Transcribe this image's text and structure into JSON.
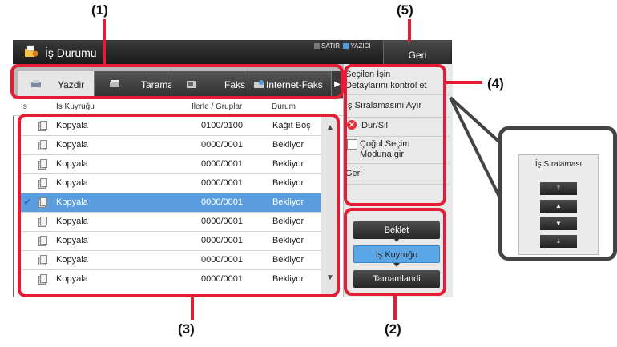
{
  "callouts": [
    "(1)",
    "(5)",
    "(4)",
    "(3)",
    "(2)"
  ],
  "window": {
    "title": "İş Durumu",
    "back": "Geri",
    "indicator_1": "SATIR",
    "indicator_2": "YAZICI"
  },
  "tabs": [
    {
      "label": "Yazdir",
      "icon": "printer-icon"
    },
    {
      "label": "Tarama",
      "icon": "scanner-icon"
    },
    {
      "label": "Faks",
      "icon": "fax-icon"
    },
    {
      "label": "Internet-Faks",
      "icon": "internet-fax-icon"
    }
  ],
  "columns": {
    "c0": "Is",
    "c1": "İs Kuyruğu",
    "c2": "Ilerle / Gruplar",
    "c3": "Durum"
  },
  "rows": [
    {
      "name": "Kopyala",
      "progress": "0100/0100",
      "status": "Kağıt Boş"
    },
    {
      "name": "Kopyala",
      "progress": "0000/0001",
      "status": "Bekliyor"
    },
    {
      "name": "Kopyala",
      "progress": "0000/0001",
      "status": "Bekliyor"
    },
    {
      "name": "Kopyala",
      "progress": "0000/0001",
      "status": "Bekliyor"
    },
    {
      "name": "Kopyala",
      "progress": "0000/0001",
      "status": "Bekliyor"
    },
    {
      "name": "Kopyala",
      "progress": "0000/0001",
      "status": "Bekliyor"
    },
    {
      "name": "Kopyala",
      "progress": "0000/0001",
      "status": "Bekliyor"
    },
    {
      "name": "Kopyala",
      "progress": "0000/0001",
      "status": "Bekliyor"
    },
    {
      "name": "Kopyala",
      "progress": "0000/0001",
      "status": "Bekliyor"
    }
  ],
  "selected_row": 4,
  "right_menu": {
    "details_1": "Seçilen İşin",
    "details_2": "Detaylarını kontrol et",
    "separate": "İş Sıralamasını Ayır",
    "stop": "Dur/Sil",
    "multi_1": "Çoğul Seçim",
    "multi_2": "Moduna gir",
    "back": "Geri"
  },
  "status_buttons": {
    "hold": "Beklet",
    "queue": "İş Kuyruğu",
    "complete": "Tamamlandi"
  },
  "zoom": {
    "title": "İş Sıralaması"
  },
  "colors": {
    "highlight": "#e41c35",
    "selected_row": "#5a9ee0",
    "active_button": "#5aa6e6"
  }
}
